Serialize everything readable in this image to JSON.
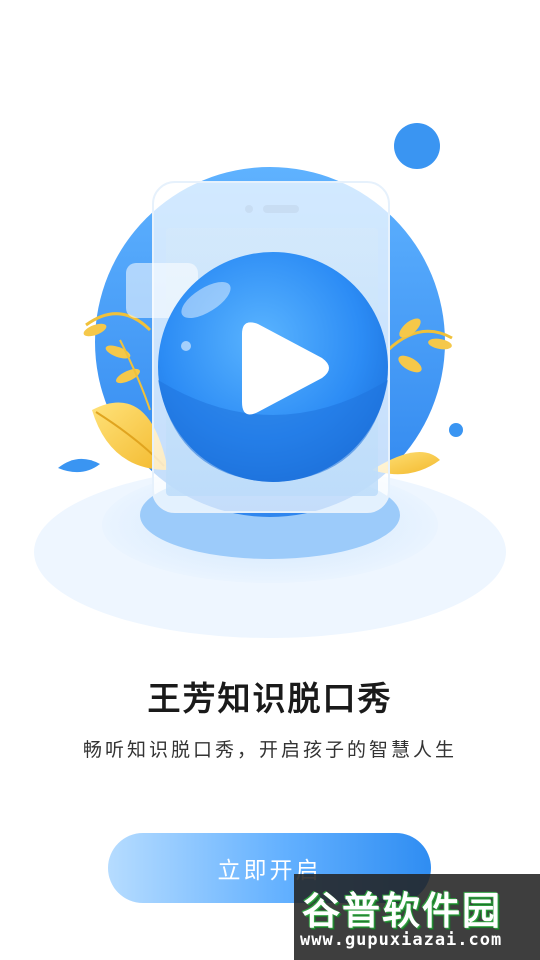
{
  "app": {
    "title": "王芳知识脱口秀",
    "subtitle": "畅听知识脱口秀，开启孩子的智慧人生"
  },
  "start_button": {
    "label": "立即开启"
  },
  "watermark": {
    "text": "谷普软件园",
    "url": "www.gupuxiazai.com"
  },
  "colors": {
    "accent": "#2f8df2",
    "button_start": "#b6dcff",
    "button_end": "#2f8df2",
    "leaf": "#f5c84a"
  },
  "icons": [
    "play-icon",
    "phone-illustration",
    "leaf-decoration"
  ]
}
